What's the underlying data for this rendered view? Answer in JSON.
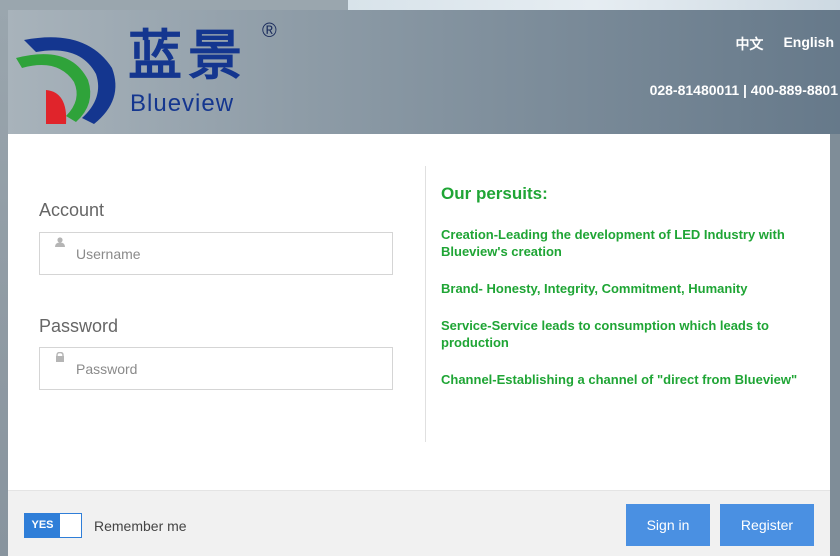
{
  "header": {
    "logo": {
      "cn_text": "蓝景",
      "en_text": "Blueview",
      "reg_mark": "®"
    },
    "languages": [
      "中文",
      "English"
    ],
    "phone": "028-81480011 | 400-889-8801"
  },
  "login": {
    "account_label": "Account",
    "username_placeholder": "Username",
    "username_value": "",
    "password_label": "Password",
    "password_placeholder": "Password",
    "password_value": ""
  },
  "pursuits": {
    "title": "Our persuits:",
    "items": [
      "Creation-Leading the development of LED Industry with Blueview's creation",
      "Brand- Honesty, Integrity, Commitment, Humanity",
      "Service-Service leads to consumption which leads to production",
      "Channel-Establishing a channel of \"direct from Blueview\""
    ]
  },
  "footer": {
    "toggle_label": "YES",
    "toggle_on": true,
    "remember_label": "Remember me",
    "signin_label": "Sign in",
    "register_label": "Register"
  },
  "colors": {
    "logo_blue": "#14368f",
    "accent_green": "#1fa535",
    "button_blue": "#4a90e2",
    "toggle_blue": "#2f7ed8"
  }
}
